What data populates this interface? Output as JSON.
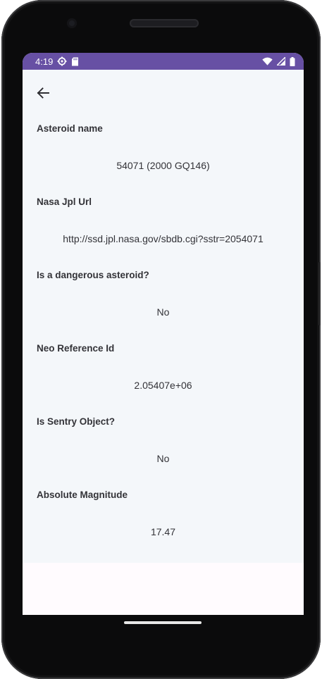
{
  "status_bar": {
    "time": "4:19",
    "icons_left": [
      "gear-icon",
      "sd-card-icon"
    ],
    "icons_right": [
      "wifi-icon",
      "signal-icon",
      "battery-icon"
    ]
  },
  "toolbar": {
    "back_icon": "arrow-back-icon"
  },
  "fields": [
    {
      "label": "Asteroid name",
      "value": "54071 (2000 GQ146)"
    },
    {
      "label": "Nasa Jpl Url",
      "value": "http://ssd.jpl.nasa.gov/sbdb.cgi?sstr=2054071"
    },
    {
      "label": "Is a dangerous asteroid?",
      "value": "No"
    },
    {
      "label": "Neo Reference Id",
      "value": "2.05407e+06"
    },
    {
      "label": "Is Sentry Object?",
      "value": "No"
    },
    {
      "label": "Absolute Magnitude",
      "value": "17.47"
    }
  ],
  "colors": {
    "status_bar": "#6750a4",
    "content_bg": "#f4f7fa",
    "screen_bg": "#fffbfe",
    "text": "#333338"
  }
}
